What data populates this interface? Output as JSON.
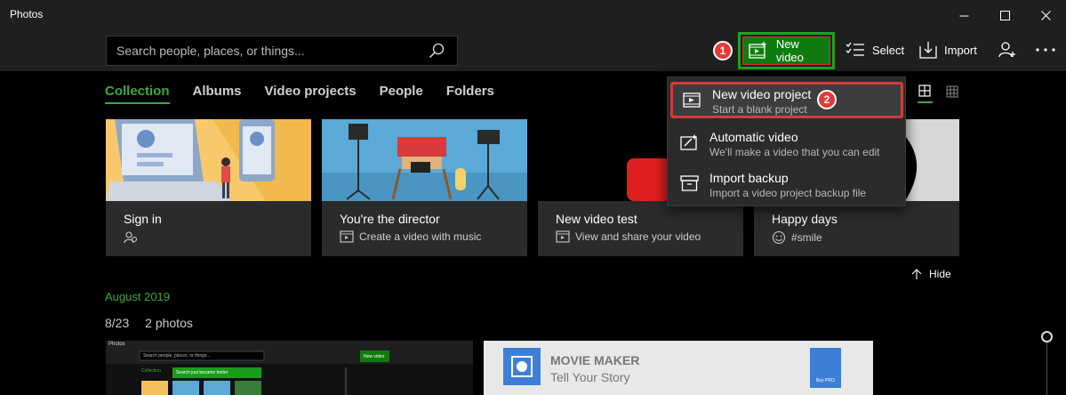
{
  "window": {
    "title": "Photos"
  },
  "toolbar": {
    "search_placeholder": "Search people, places, or things...",
    "new_video_label": "New video",
    "select_label": "Select",
    "import_label": "Import"
  },
  "badges": {
    "step1": "1",
    "step2": "2"
  },
  "tabs": [
    {
      "label": "Collection",
      "active": true
    },
    {
      "label": "Albums"
    },
    {
      "label": "Video projects"
    },
    {
      "label": "People"
    },
    {
      "label": "Folders"
    }
  ],
  "menu": {
    "items": [
      {
        "title": "New video project",
        "subtitle": "Start a blank project",
        "icon": "new-video-project-icon"
      },
      {
        "title": "Automatic video",
        "subtitle": "We'll make a video that you can edit",
        "icon": "magic-video-icon"
      },
      {
        "title": "Import backup",
        "subtitle": "Import a video project backup file",
        "icon": "archive-box-icon"
      }
    ]
  },
  "cards": [
    {
      "title": "Sign in",
      "subtitle": "",
      "icon": "people-sign-in-icon"
    },
    {
      "title": "You're the director",
      "subtitle": "Create a video with music",
      "icon": "video-icon"
    },
    {
      "title": "New video test",
      "subtitle": "View and share your video",
      "icon": "video-icon"
    },
    {
      "title": "Happy days",
      "subtitle": "#smile",
      "icon": "smiley-icon"
    }
  ],
  "hide_label": "Hide",
  "collection": {
    "month": "August 2019",
    "date": "8/23",
    "count": "2 photos"
  },
  "photos": {
    "thumb1": {
      "title": "Photos",
      "search_text": "Search people, places, or things...",
      "new_video": "New video",
      "tab": "Collection",
      "tooltip": "Search just became better"
    },
    "thumb2": {
      "title": "MOVIE MAKER",
      "tagline": "Tell Your Story",
      "buy": "Buy PRO"
    }
  },
  "colors": {
    "accent": "#107c10",
    "highlight": "#d63a3a",
    "green_text": "#3fa83f"
  }
}
